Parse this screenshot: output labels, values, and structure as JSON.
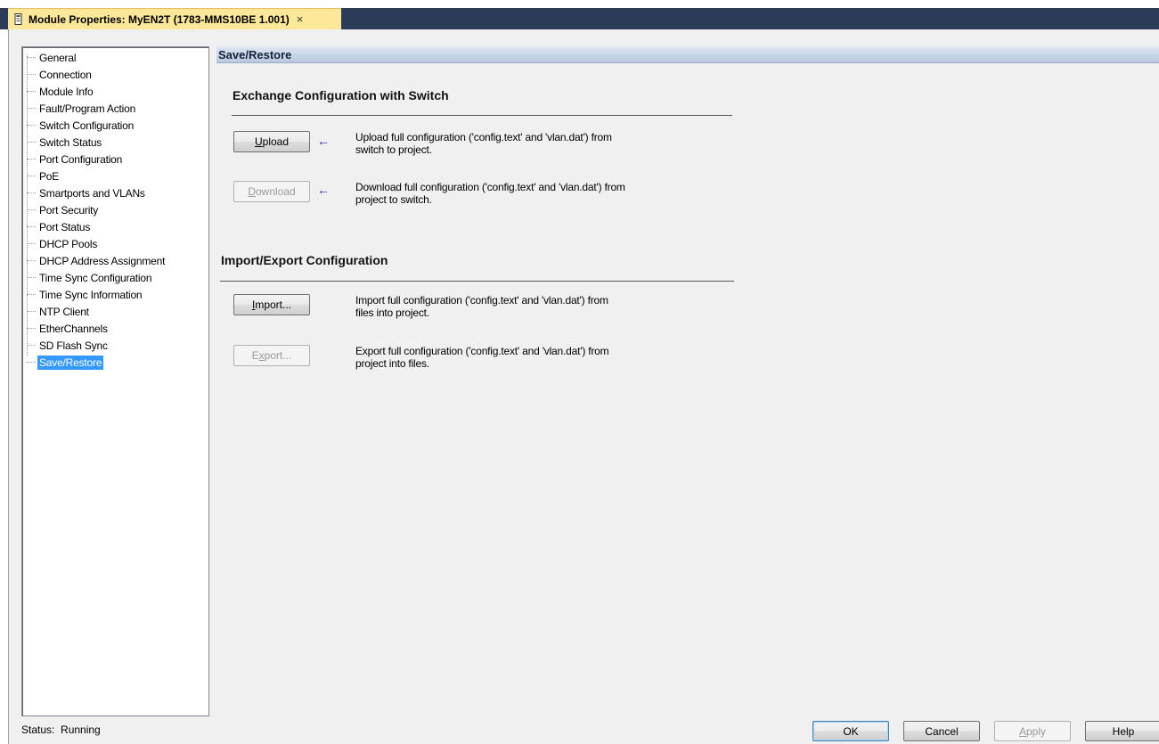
{
  "window": {
    "tab_title": "Module Properties: MyEN2T (1783-MMS10BE 1.001)",
    "tab_close": "×"
  },
  "tree": {
    "items": [
      {
        "label": "General",
        "selected": false
      },
      {
        "label": "Connection",
        "selected": false
      },
      {
        "label": "Module Info",
        "selected": false
      },
      {
        "label": "Fault/Program Action",
        "selected": false
      },
      {
        "label": "Switch Configuration",
        "selected": false
      },
      {
        "label": "Switch Status",
        "selected": false
      },
      {
        "label": "Port Configuration",
        "selected": false
      },
      {
        "label": "PoE",
        "selected": false
      },
      {
        "label": "Smartports and VLANs",
        "selected": false
      },
      {
        "label": "Port Security",
        "selected": false
      },
      {
        "label": "Port Status",
        "selected": false
      },
      {
        "label": "DHCP Pools",
        "selected": false
      },
      {
        "label": "DHCP Address Assignment",
        "selected": false
      },
      {
        "label": "Time Sync Configuration",
        "selected": false
      },
      {
        "label": "Time Sync Information",
        "selected": false
      },
      {
        "label": "NTP Client",
        "selected": false
      },
      {
        "label": "EtherChannels",
        "selected": false
      },
      {
        "label": "SD Flash Sync",
        "selected": false
      },
      {
        "label": "Save/Restore",
        "selected": true
      }
    ]
  },
  "main": {
    "header": "Save/Restore",
    "exchange": {
      "title": "Exchange Configuration with Switch",
      "upload_label": "Upload",
      "upload_desc_1": "Upload full configuration ('config.text' and 'vlan.dat') from",
      "upload_desc_2": "switch to project.",
      "download_label": "Download",
      "download_desc_1": "Download full configuration ('config.text' and 'vlan.dat') from",
      "download_desc_2": "project to switch.",
      "arrow": "←"
    },
    "importexport": {
      "title": "Import/Export Configuration",
      "import_label": "Import...",
      "import_desc_1": "Import full configuration ('config.text' and 'vlan.dat') from",
      "import_desc_2": "files into project.",
      "export_label": "Export...",
      "export_desc_1": "Export full configuration ('config.text' and 'vlan.dat') from",
      "export_desc_2": "project into files."
    }
  },
  "footer": {
    "status": "Status:  Running",
    "ok": "OK",
    "cancel": "Cancel",
    "apply": "Apply",
    "help": "Help"
  },
  "colors": {
    "titlebar": "#2c3b57",
    "tab": "#fde899",
    "selection": "#3399ff",
    "arrow": "#1a2aa0"
  }
}
